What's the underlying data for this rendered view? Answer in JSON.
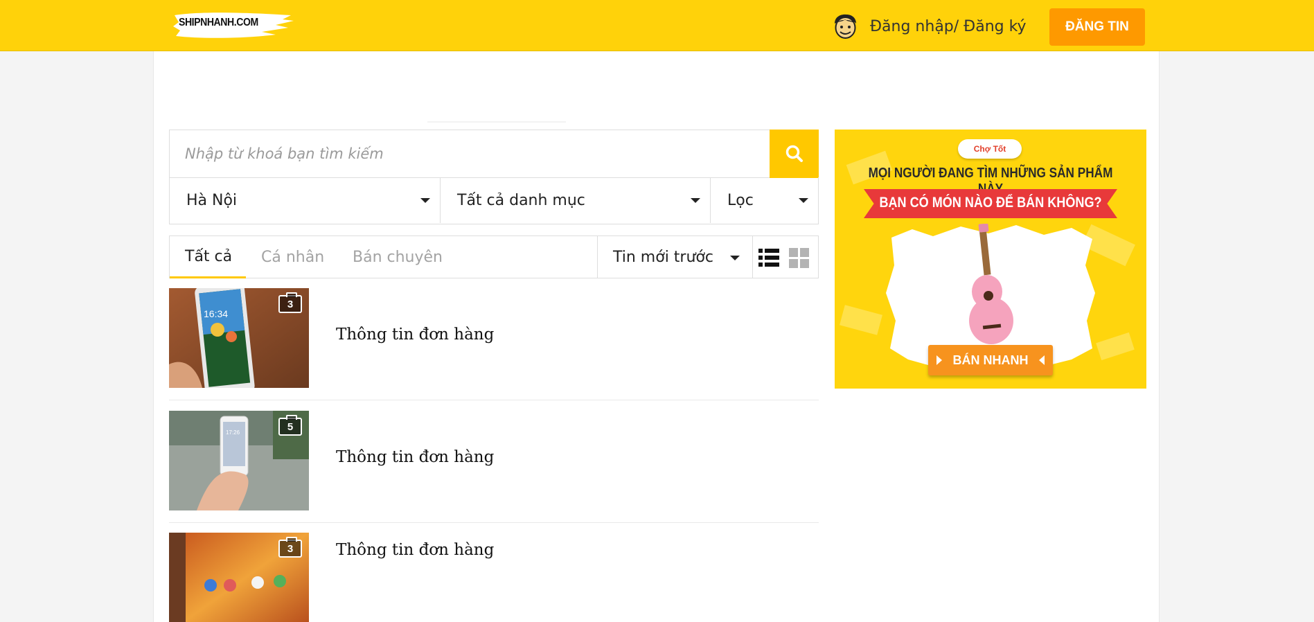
{
  "header": {
    "logo_text": "SHIPNHANH.COM",
    "login_label": "Đăng nhập/ Đăng ký",
    "post_button": "ĐĂNG TIN",
    "bg_color": "#ffd20a",
    "accent_color": "#fe9900"
  },
  "search": {
    "placeholder": "Nhập từ khoá bạn tìm kiếm",
    "value": "",
    "button_icon": "search-icon"
  },
  "filters": {
    "location": "Hà Nội",
    "category": "Tất cả danh mục",
    "filter": "Lọc"
  },
  "tabs": [
    {
      "label": "Tất cả",
      "active": true
    },
    {
      "label": "Cá nhân",
      "active": false
    },
    {
      "label": "Bán chuyên",
      "active": false
    }
  ],
  "sort": {
    "label": "Tin mới trước"
  },
  "view_modes": [
    "list-view-icon",
    "grid-view-icon"
  ],
  "listings": [
    {
      "title": "Thông tin đơn hàng",
      "photo_count": "3"
    },
    {
      "title": "Thông tin đơn hàng",
      "photo_count": "5"
    },
    {
      "title": "Thông tin đơn hàng",
      "photo_count": "3"
    }
  ],
  "ad": {
    "brand": "Chợ Tốt",
    "line1": "MỌI NGƯỜI ĐANG TÌM NHỮNG SẢN PHẨM NÀY",
    "line2": "BẠN CÓ MÓN NÀO ĐỂ BÁN KHÔNG?",
    "cta": "BÁN NHANH"
  }
}
